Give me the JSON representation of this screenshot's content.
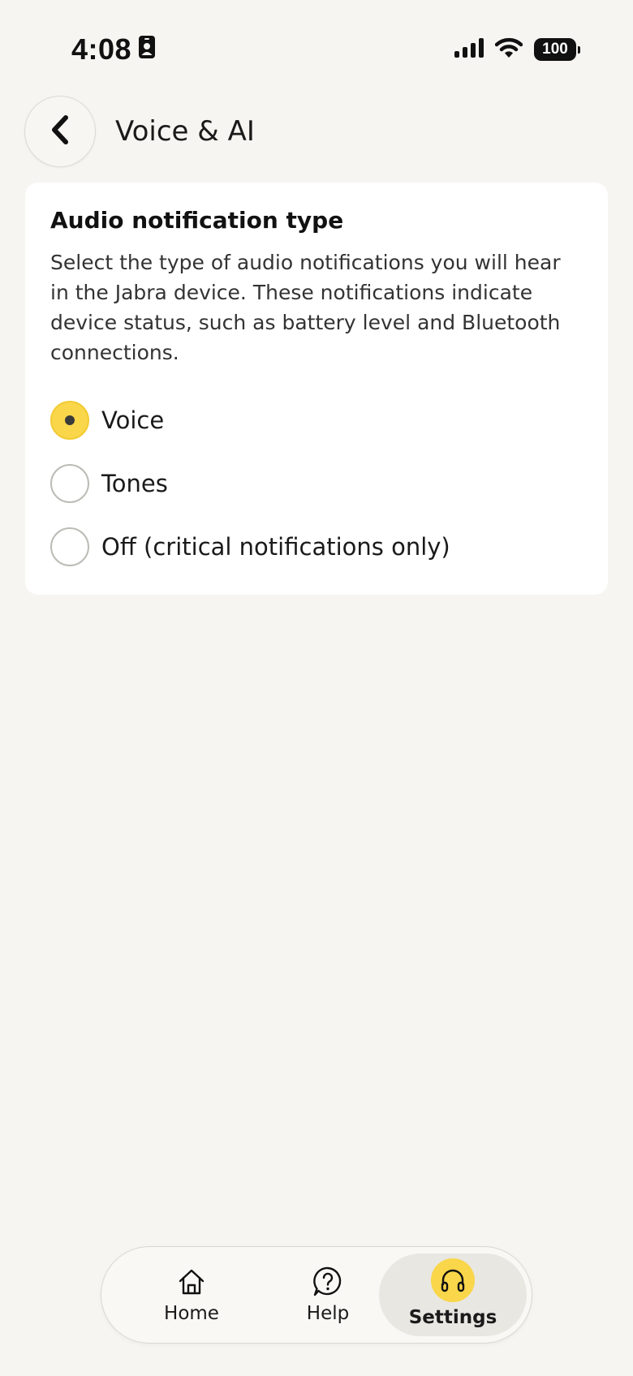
{
  "status_bar": {
    "time": "4:08",
    "battery": "100",
    "icons": [
      "id-card-icon",
      "signal-icon",
      "wifi-icon",
      "battery-icon"
    ]
  },
  "header": {
    "title": "Voice & AI",
    "back_icon": "chevron-left-icon"
  },
  "audio_notification": {
    "title": "Audio notification type",
    "description": "Select the type of audio notifications you will hear in the Jabra device. These notifications indicate device status, such as battery level and Bluetooth connections.",
    "options": [
      {
        "label": "Voice",
        "selected": true
      },
      {
        "label": "Tones",
        "selected": false
      },
      {
        "label": "Off (critical notifications only)",
        "selected": false
      }
    ]
  },
  "bottom_nav": {
    "items": [
      {
        "label": "Home",
        "icon": "home-icon",
        "active": false
      },
      {
        "label": "Help",
        "icon": "help-icon",
        "active": false
      },
      {
        "label": "Settings",
        "icon": "headphones-icon",
        "active": true
      }
    ]
  },
  "colors": {
    "background": "#F6F5F1",
    "card": "#FFFFFF",
    "accent": "#F9D64A",
    "active_nav_bg": "#E9E7E2"
  }
}
